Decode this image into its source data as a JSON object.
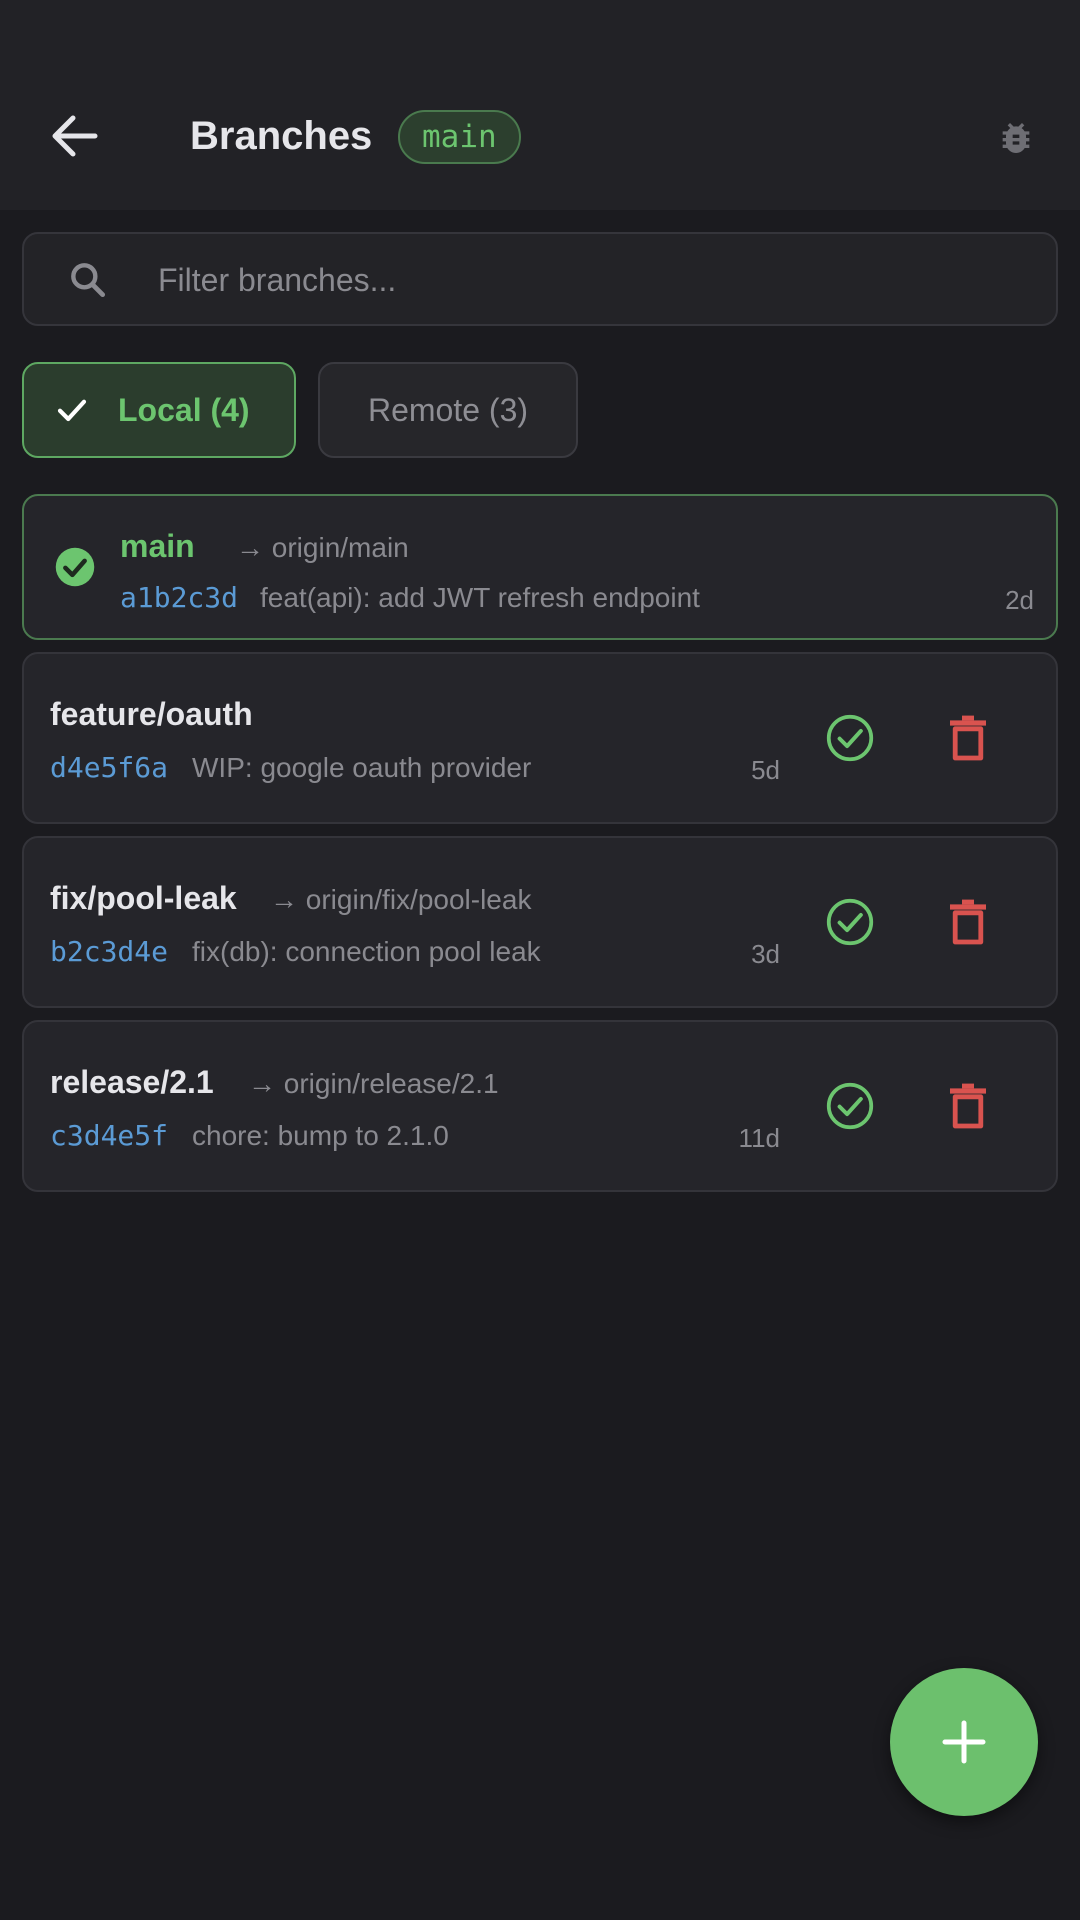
{
  "header": {
    "title": "Branches",
    "current_branch_badge": "main"
  },
  "search": {
    "placeholder": "Filter branches...",
    "value": ""
  },
  "tabs": [
    {
      "label": "Local (4)",
      "selected": true
    },
    {
      "label": "Remote (3)",
      "selected": false
    }
  ],
  "branches": [
    {
      "name": "main",
      "upstream": "→ origin/main",
      "sha": "a1b2c3d",
      "message": "feat(api): add JWT refresh endpoint",
      "age": "2d",
      "current": true
    },
    {
      "name": "feature/oauth",
      "upstream": "",
      "sha": "d4e5f6a",
      "message": "WIP: google oauth provider",
      "age": "5d",
      "current": false
    },
    {
      "name": "fix/pool-leak",
      "upstream": "→ origin/fix/pool-leak",
      "sha": "b2c3d4e",
      "message": "fix(db): connection pool leak",
      "age": "3d",
      "current": false
    },
    {
      "name": "release/2.1",
      "upstream": "→ origin/release/2.1",
      "sha": "c3d4e5f",
      "message": "chore: bump to 2.1.0",
      "age": "11d",
      "current": false
    }
  ],
  "icons": {
    "back": "arrow-left-icon",
    "debug": "bug-icon",
    "search": "search-icon",
    "tab_check": "check-icon",
    "checkout": "check-circle-icon",
    "delete": "trash-icon",
    "add": "plus-icon"
  },
  "colors": {
    "accent_green": "#6cc56f",
    "sha_blue": "#5b9bd5",
    "delete_red": "#d9534f",
    "background": "#1b1b1f"
  }
}
